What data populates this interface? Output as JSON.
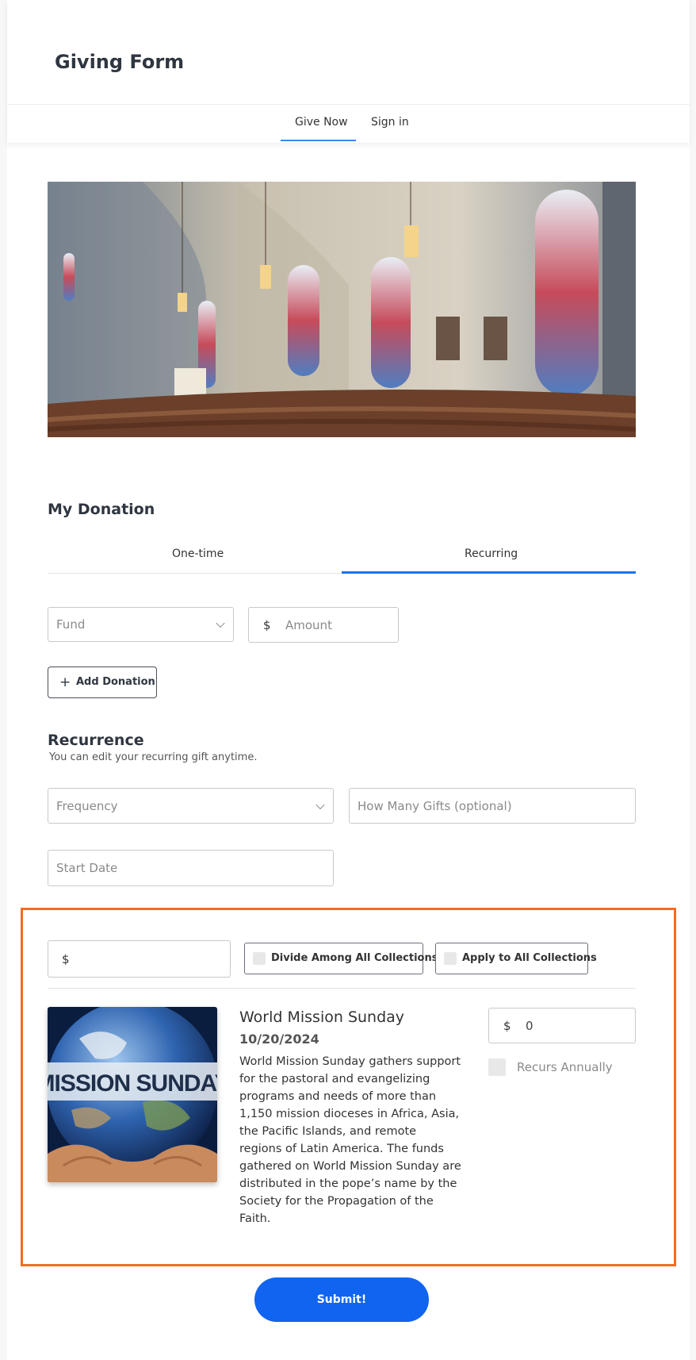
{
  "header": {
    "title": "Giving Form",
    "tabs": [
      {
        "label": "Give Now",
        "active": true
      },
      {
        "label": "Sign in",
        "active": false
      }
    ]
  },
  "hero": {
    "icon": "church-interior-photo"
  },
  "donation": {
    "title": "My Donation",
    "tabs": [
      {
        "label": "One-time",
        "active": false
      },
      {
        "label": "Recurring",
        "active": true
      }
    ],
    "fund_placeholder": "Fund",
    "currency_symbol": "$",
    "amount_placeholder": "Amount",
    "add_button_icon": "+",
    "add_button_label": "Add Donation"
  },
  "recurrence": {
    "title": "Recurrence",
    "subtitle": "You can edit your recurring gift anytime.",
    "frequency_placeholder": "Frequency",
    "how_many_placeholder": "How Many Gifts  (optional)",
    "start_date_placeholder": "Start Date"
  },
  "collections": {
    "bulk_currency": "$",
    "divide_label": "Divide Among All Collections",
    "apply_label": "Apply to All Collections",
    "items": [
      {
        "image_text": "MISSION SUNDAY",
        "title": "World Mission Sunday",
        "date": "10/20/2024",
        "description": "World Mission Sunday gathers support for the pastoral and evangelizing programs and needs of more than 1,150 mission dioceses in Africa, Asia, the Pacific Islands, and remote regions of Latin America. The funds gathered on World Mission Sunday are distributed in the pope’s name by the Society for the Propagation of the Faith.",
        "currency": "$",
        "amount": "0",
        "recurs_label": "Recurs Annually"
      }
    ]
  },
  "submit_label": "Submit!",
  "colors": {
    "accent_blue": "#1f73e8",
    "submit_blue": "#1064f0",
    "highlight_orange": "#f26d21"
  }
}
